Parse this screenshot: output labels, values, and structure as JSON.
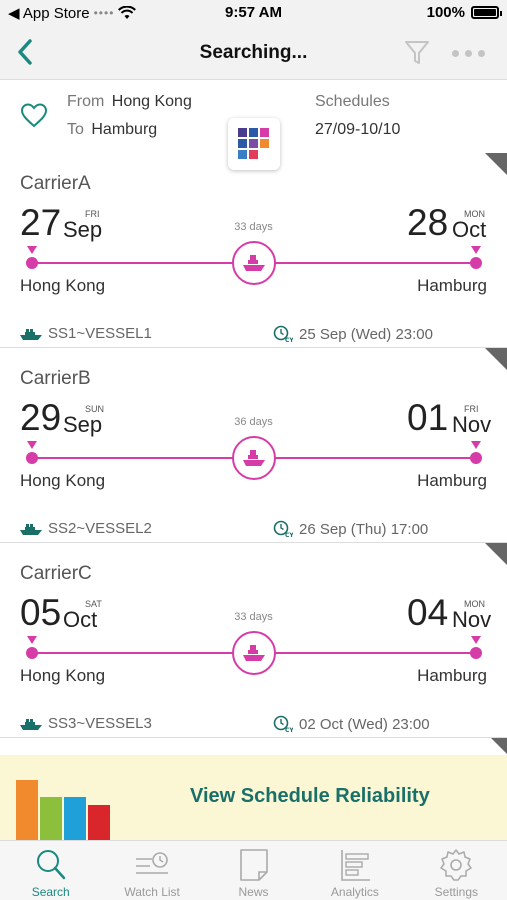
{
  "status_bar": {
    "carrier_label": "◀ App Store",
    "signal": "••••",
    "time": "9:57 AM",
    "battery": "100%"
  },
  "nav": {
    "title": "Searching..."
  },
  "route": {
    "from_label": "From",
    "from_city": "Hong Kong",
    "to_label": "To",
    "to_city": "Hamburg",
    "schedules_label": "Schedules",
    "schedules_range": "27/09-10/10"
  },
  "schedules": [
    {
      "carrier": "CarrierA",
      "dep_day": "27",
      "dep_month": "Sep",
      "dep_weekday": "FRI",
      "arr_day": "28",
      "arr_month": "Oct",
      "arr_weekday": "MON",
      "transit": "33 days",
      "origin": "Hong Kong",
      "destination": "Hamburg",
      "vessel": "SS1~VESSEL1",
      "cutoff": "25 Sep (Wed) 23:00"
    },
    {
      "carrier": "CarrierB",
      "dep_day": "29",
      "dep_month": "Sep",
      "dep_weekday": "SUN",
      "arr_day": "01",
      "arr_month": "Nov",
      "arr_weekday": "FRI",
      "transit": "36 days",
      "origin": "Hong Kong",
      "destination": "Hamburg",
      "vessel": "SS2~VESSEL2",
      "cutoff": "26 Sep (Thu) 17:00"
    },
    {
      "carrier": "CarrierC",
      "dep_day": "05",
      "dep_month": "Oct",
      "dep_weekday": "SAT",
      "arr_day": "04",
      "arr_month": "Nov",
      "arr_weekday": "MON",
      "transit": "33 days",
      "origin": "Hong Kong",
      "destination": "Hamburg",
      "vessel": "SS3~VESSEL3",
      "cutoff": "02 Oct (Wed) 23:00"
    }
  ],
  "banner": {
    "text": "View Schedule Reliability"
  },
  "tabs": [
    {
      "label": "Search",
      "icon": "search-icon",
      "active": true
    },
    {
      "label": "Watch List",
      "icon": "watch-list-icon",
      "active": false
    },
    {
      "label": "News",
      "icon": "news-icon",
      "active": false
    },
    {
      "label": "Analytics",
      "icon": "analytics-icon",
      "active": false
    },
    {
      "label": "Settings",
      "icon": "settings-icon",
      "active": false
    }
  ],
  "colors": {
    "accent": "#1a8a80",
    "route_line": "#d63ca8",
    "banner_bg": "#fbf7d4",
    "banner_text": "#1a7068"
  }
}
